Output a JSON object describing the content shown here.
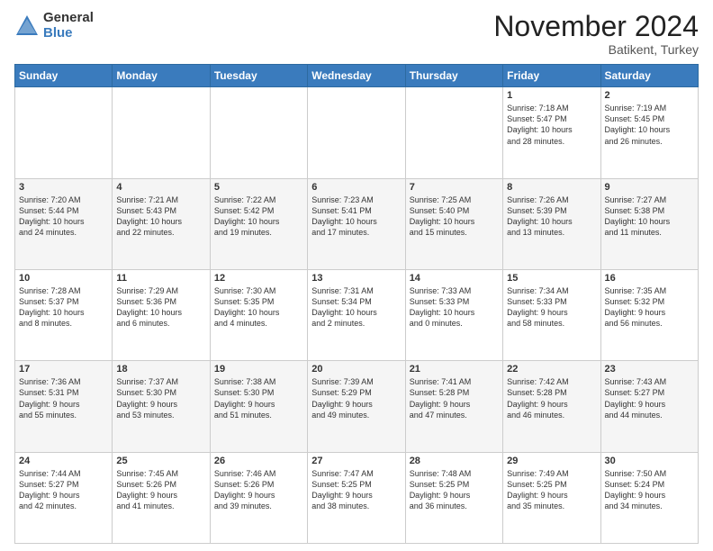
{
  "header": {
    "logo_general": "General",
    "logo_blue": "Blue",
    "month_title": "November 2024",
    "location": "Batikent, Turkey"
  },
  "days_of_week": [
    "Sunday",
    "Monday",
    "Tuesday",
    "Wednesday",
    "Thursday",
    "Friday",
    "Saturday"
  ],
  "weeks": [
    [
      {
        "day": "",
        "info": ""
      },
      {
        "day": "",
        "info": ""
      },
      {
        "day": "",
        "info": ""
      },
      {
        "day": "",
        "info": ""
      },
      {
        "day": "",
        "info": ""
      },
      {
        "day": "1",
        "info": "Sunrise: 7:18 AM\nSunset: 5:47 PM\nDaylight: 10 hours\nand 28 minutes."
      },
      {
        "day": "2",
        "info": "Sunrise: 7:19 AM\nSunset: 5:45 PM\nDaylight: 10 hours\nand 26 minutes."
      }
    ],
    [
      {
        "day": "3",
        "info": "Sunrise: 7:20 AM\nSunset: 5:44 PM\nDaylight: 10 hours\nand 24 minutes."
      },
      {
        "day": "4",
        "info": "Sunrise: 7:21 AM\nSunset: 5:43 PM\nDaylight: 10 hours\nand 22 minutes."
      },
      {
        "day": "5",
        "info": "Sunrise: 7:22 AM\nSunset: 5:42 PM\nDaylight: 10 hours\nand 19 minutes."
      },
      {
        "day": "6",
        "info": "Sunrise: 7:23 AM\nSunset: 5:41 PM\nDaylight: 10 hours\nand 17 minutes."
      },
      {
        "day": "7",
        "info": "Sunrise: 7:25 AM\nSunset: 5:40 PM\nDaylight: 10 hours\nand 15 minutes."
      },
      {
        "day": "8",
        "info": "Sunrise: 7:26 AM\nSunset: 5:39 PM\nDaylight: 10 hours\nand 13 minutes."
      },
      {
        "day": "9",
        "info": "Sunrise: 7:27 AM\nSunset: 5:38 PM\nDaylight: 10 hours\nand 11 minutes."
      }
    ],
    [
      {
        "day": "10",
        "info": "Sunrise: 7:28 AM\nSunset: 5:37 PM\nDaylight: 10 hours\nand 8 minutes."
      },
      {
        "day": "11",
        "info": "Sunrise: 7:29 AM\nSunset: 5:36 PM\nDaylight: 10 hours\nand 6 minutes."
      },
      {
        "day": "12",
        "info": "Sunrise: 7:30 AM\nSunset: 5:35 PM\nDaylight: 10 hours\nand 4 minutes."
      },
      {
        "day": "13",
        "info": "Sunrise: 7:31 AM\nSunset: 5:34 PM\nDaylight: 10 hours\nand 2 minutes."
      },
      {
        "day": "14",
        "info": "Sunrise: 7:33 AM\nSunset: 5:33 PM\nDaylight: 10 hours\nand 0 minutes."
      },
      {
        "day": "15",
        "info": "Sunrise: 7:34 AM\nSunset: 5:33 PM\nDaylight: 9 hours\nand 58 minutes."
      },
      {
        "day": "16",
        "info": "Sunrise: 7:35 AM\nSunset: 5:32 PM\nDaylight: 9 hours\nand 56 minutes."
      }
    ],
    [
      {
        "day": "17",
        "info": "Sunrise: 7:36 AM\nSunset: 5:31 PM\nDaylight: 9 hours\nand 55 minutes."
      },
      {
        "day": "18",
        "info": "Sunrise: 7:37 AM\nSunset: 5:30 PM\nDaylight: 9 hours\nand 53 minutes."
      },
      {
        "day": "19",
        "info": "Sunrise: 7:38 AM\nSunset: 5:30 PM\nDaylight: 9 hours\nand 51 minutes."
      },
      {
        "day": "20",
        "info": "Sunrise: 7:39 AM\nSunset: 5:29 PM\nDaylight: 9 hours\nand 49 minutes."
      },
      {
        "day": "21",
        "info": "Sunrise: 7:41 AM\nSunset: 5:28 PM\nDaylight: 9 hours\nand 47 minutes."
      },
      {
        "day": "22",
        "info": "Sunrise: 7:42 AM\nSunset: 5:28 PM\nDaylight: 9 hours\nand 46 minutes."
      },
      {
        "day": "23",
        "info": "Sunrise: 7:43 AM\nSunset: 5:27 PM\nDaylight: 9 hours\nand 44 minutes."
      }
    ],
    [
      {
        "day": "24",
        "info": "Sunrise: 7:44 AM\nSunset: 5:27 PM\nDaylight: 9 hours\nand 42 minutes."
      },
      {
        "day": "25",
        "info": "Sunrise: 7:45 AM\nSunset: 5:26 PM\nDaylight: 9 hours\nand 41 minutes."
      },
      {
        "day": "26",
        "info": "Sunrise: 7:46 AM\nSunset: 5:26 PM\nDaylight: 9 hours\nand 39 minutes."
      },
      {
        "day": "27",
        "info": "Sunrise: 7:47 AM\nSunset: 5:25 PM\nDaylight: 9 hours\nand 38 minutes."
      },
      {
        "day": "28",
        "info": "Sunrise: 7:48 AM\nSunset: 5:25 PM\nDaylight: 9 hours\nand 36 minutes."
      },
      {
        "day": "29",
        "info": "Sunrise: 7:49 AM\nSunset: 5:25 PM\nDaylight: 9 hours\nand 35 minutes."
      },
      {
        "day": "30",
        "info": "Sunrise: 7:50 AM\nSunset: 5:24 PM\nDaylight: 9 hours\nand 34 minutes."
      }
    ]
  ]
}
